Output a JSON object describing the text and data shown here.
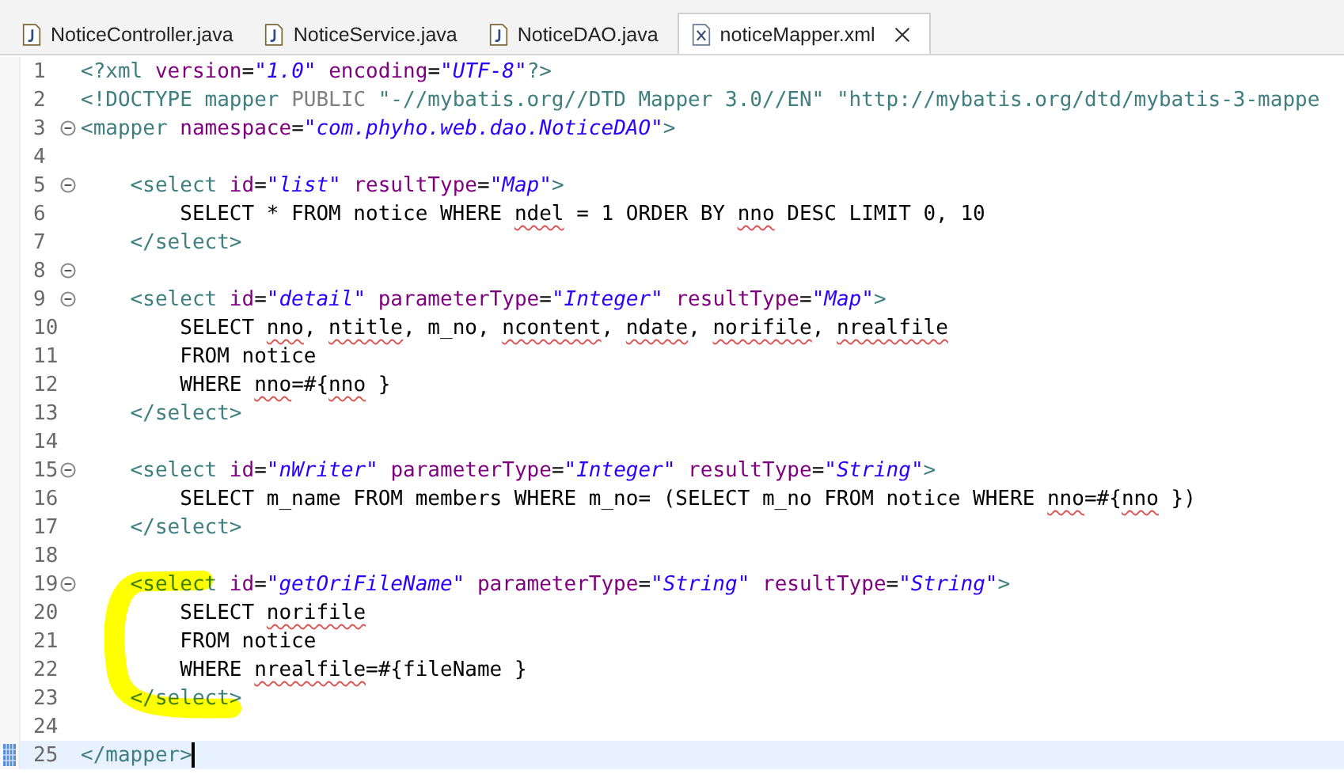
{
  "tabs": [
    {
      "label": "NoticeController.java",
      "kind": "java",
      "selected": false
    },
    {
      "label": "NoticeService.java",
      "kind": "java",
      "selected": false
    },
    {
      "label": "NoticeDAO.java",
      "kind": "java",
      "selected": false
    },
    {
      "label": "noticeMapper.xml",
      "kind": "xml",
      "selected": true
    }
  ],
  "editor": {
    "lines": [
      {
        "number": "1",
        "foldable": false,
        "current": false,
        "tokens": [
          {
            "text": "<?xml ",
            "kind": "tag"
          },
          {
            "text": "version",
            "kind": "attr"
          },
          {
            "text": "=",
            "kind": "text"
          },
          {
            "text": "\"1.0\" ",
            "kind": "value"
          },
          {
            "text": "encoding",
            "kind": "attr"
          },
          {
            "text": "=",
            "kind": "text"
          },
          {
            "text": "\"UTF-8\"",
            "kind": "value"
          },
          {
            "text": "?>",
            "kind": "tag"
          }
        ]
      },
      {
        "number": "2",
        "foldable": false,
        "current": false,
        "tokens": [
          {
            "text": "<!DOCTYPE mapper ",
            "kind": "tag"
          },
          {
            "text": "PUBLIC ",
            "kind": "keyword"
          },
          {
            "text": "\"-//mybatis.org//DTD Mapper 3.0//EN\" ",
            "kind": "dtd"
          },
          {
            "text": "\"http://mybatis.org/dtd/mybatis-3-mappe",
            "kind": "dtd"
          }
        ]
      },
      {
        "number": "3",
        "foldable": true,
        "current": false,
        "tokens": [
          {
            "text": "<mapper ",
            "kind": "tag"
          },
          {
            "text": "namespace",
            "kind": "attr"
          },
          {
            "text": "=",
            "kind": "text"
          },
          {
            "text": "\"com.phyho.web.dao.NoticeDAO\"",
            "kind": "value"
          },
          {
            "text": ">",
            "kind": "tag"
          }
        ]
      },
      {
        "number": "4",
        "foldable": false,
        "current": false
      },
      {
        "number": "5",
        "foldable": true,
        "current": false,
        "tokens": [
          {
            "text": "    <select ",
            "kind": "tag"
          },
          {
            "text": "id",
            "kind": "attr"
          },
          {
            "text": "=",
            "kind": "text"
          },
          {
            "text": "\"list\" ",
            "kind": "value"
          },
          {
            "text": "resultType",
            "kind": "attr"
          },
          {
            "text": "=",
            "kind": "text"
          },
          {
            "text": "\"Map\"",
            "kind": "value"
          },
          {
            "text": ">",
            "kind": "tag"
          }
        ]
      },
      {
        "number": "6",
        "foldable": false,
        "current": false,
        "tokens": [
          {
            "text": "        SELECT * FROM notice WHERE ",
            "kind": "text"
          },
          {
            "text": "ndel",
            "kind": "text",
            "misspelled": true
          },
          {
            "text": " = 1 ORDER BY ",
            "kind": "text"
          },
          {
            "text": "nno",
            "kind": "text",
            "misspelled": true
          },
          {
            "text": " DESC LIMIT 0, 10",
            "kind": "text"
          }
        ]
      },
      {
        "number": "7",
        "foldable": false,
        "current": false,
        "tokens": [
          {
            "text": "    </select>",
            "kind": "tag"
          }
        ]
      },
      {
        "number": "8",
        "foldable": true,
        "current": false
      },
      {
        "number": "9",
        "foldable": true,
        "current": false,
        "tokens": [
          {
            "text": "    <select ",
            "kind": "tag"
          },
          {
            "text": "id",
            "kind": "attr"
          },
          {
            "text": "=",
            "kind": "text"
          },
          {
            "text": "\"detail\" ",
            "kind": "value"
          },
          {
            "text": "parameterType",
            "kind": "attr"
          },
          {
            "text": "=",
            "kind": "text"
          },
          {
            "text": "\"Integer\" ",
            "kind": "value"
          },
          {
            "text": "resultType",
            "kind": "attr"
          },
          {
            "text": "=",
            "kind": "text"
          },
          {
            "text": "\"Map\"",
            "kind": "value"
          },
          {
            "text": ">",
            "kind": "tag"
          }
        ]
      },
      {
        "number": "10",
        "foldable": false,
        "current": false,
        "tokens": [
          {
            "text": "        SELECT ",
            "kind": "text"
          },
          {
            "text": "nno",
            "kind": "text",
            "misspelled": true
          },
          {
            "text": ", ",
            "kind": "text"
          },
          {
            "text": "ntitle",
            "kind": "text",
            "misspelled": true
          },
          {
            "text": ", m_no, ",
            "kind": "text"
          },
          {
            "text": "ncontent",
            "kind": "text",
            "misspelled": true
          },
          {
            "text": ", ",
            "kind": "text"
          },
          {
            "text": "ndate",
            "kind": "text",
            "misspelled": true
          },
          {
            "text": ", ",
            "kind": "text"
          },
          {
            "text": "norifile",
            "kind": "text",
            "misspelled": true
          },
          {
            "text": ", ",
            "kind": "text"
          },
          {
            "text": "nrealfile",
            "kind": "text",
            "misspelled": true
          }
        ]
      },
      {
        "number": "11",
        "foldable": false,
        "current": false,
        "tokens": [
          {
            "text": "        FROM notice",
            "kind": "text"
          }
        ]
      },
      {
        "number": "12",
        "foldable": false,
        "current": false,
        "tokens": [
          {
            "text": "        WHERE ",
            "kind": "text"
          },
          {
            "text": "nno",
            "kind": "text",
            "misspelled": true
          },
          {
            "text": "=#{",
            "kind": "text"
          },
          {
            "text": "nno",
            "kind": "text",
            "misspelled": true
          },
          {
            "text": " }",
            "kind": "text"
          }
        ]
      },
      {
        "number": "13",
        "foldable": false,
        "current": false,
        "tokens": [
          {
            "text": "    </select>",
            "kind": "tag"
          }
        ]
      },
      {
        "number": "14",
        "foldable": false,
        "current": false
      },
      {
        "number": "15",
        "foldable": true,
        "current": false,
        "tokens": [
          {
            "text": "    <select ",
            "kind": "tag"
          },
          {
            "text": "id",
            "kind": "attr"
          },
          {
            "text": "=",
            "kind": "text"
          },
          {
            "text": "\"nWriter\" ",
            "kind": "value"
          },
          {
            "text": "parameterType",
            "kind": "attr"
          },
          {
            "text": "=",
            "kind": "text"
          },
          {
            "text": "\"Integer\" ",
            "kind": "value"
          },
          {
            "text": "resultType",
            "kind": "attr"
          },
          {
            "text": "=",
            "kind": "text"
          },
          {
            "text": "\"String\"",
            "kind": "value"
          },
          {
            "text": ">",
            "kind": "tag"
          }
        ]
      },
      {
        "number": "16",
        "foldable": false,
        "current": false,
        "tokens": [
          {
            "text": "        SELECT m_name FROM members WHERE m_no= (SELECT m_no FROM notice WHERE ",
            "kind": "text"
          },
          {
            "text": "nno",
            "kind": "text",
            "misspelled": true
          },
          {
            "text": "=#{",
            "kind": "text"
          },
          {
            "text": "nno",
            "kind": "text",
            "misspelled": true
          },
          {
            "text": " })",
            "kind": "text"
          }
        ]
      },
      {
        "number": "17",
        "foldable": false,
        "current": false,
        "tokens": [
          {
            "text": "    </select>",
            "kind": "tag"
          }
        ]
      },
      {
        "number": "18",
        "foldable": false,
        "current": false
      },
      {
        "number": "19",
        "foldable": true,
        "current": false,
        "tokens": [
          {
            "text": "    <select ",
            "kind": "tag"
          },
          {
            "text": "id",
            "kind": "attr"
          },
          {
            "text": "=",
            "kind": "text"
          },
          {
            "text": "\"getOriFileName\" ",
            "kind": "value"
          },
          {
            "text": "parameterType",
            "kind": "attr"
          },
          {
            "text": "=",
            "kind": "text"
          },
          {
            "text": "\"String\" ",
            "kind": "value"
          },
          {
            "text": "resultType",
            "kind": "attr"
          },
          {
            "text": "=",
            "kind": "text"
          },
          {
            "text": "\"String\"",
            "kind": "value"
          },
          {
            "text": ">",
            "kind": "tag"
          }
        ]
      },
      {
        "number": "20",
        "foldable": false,
        "current": false,
        "tokens": [
          {
            "text": "        SELECT ",
            "kind": "text"
          },
          {
            "text": "norifile",
            "kind": "text",
            "misspelled": true
          }
        ]
      },
      {
        "number": "21",
        "foldable": false,
        "current": false,
        "tokens": [
          {
            "text": "        FROM notice",
            "kind": "text"
          }
        ]
      },
      {
        "number": "22",
        "foldable": false,
        "current": false,
        "tokens": [
          {
            "text": "        WHERE ",
            "kind": "text"
          },
          {
            "text": "nrealfile",
            "kind": "text",
            "misspelled": true
          },
          {
            "text": "=#{fileName }",
            "kind": "text"
          }
        ]
      },
      {
        "number": "23",
        "foldable": false,
        "current": false,
        "tokens": [
          {
            "text": "    </select>",
            "kind": "tag"
          }
        ]
      },
      {
        "number": "24",
        "foldable": false,
        "current": false
      },
      {
        "number": "25",
        "foldable": false,
        "current": true,
        "tokens": [
          {
            "text": "</mapper>",
            "kind": "tag"
          }
        ]
      }
    ]
  }
}
